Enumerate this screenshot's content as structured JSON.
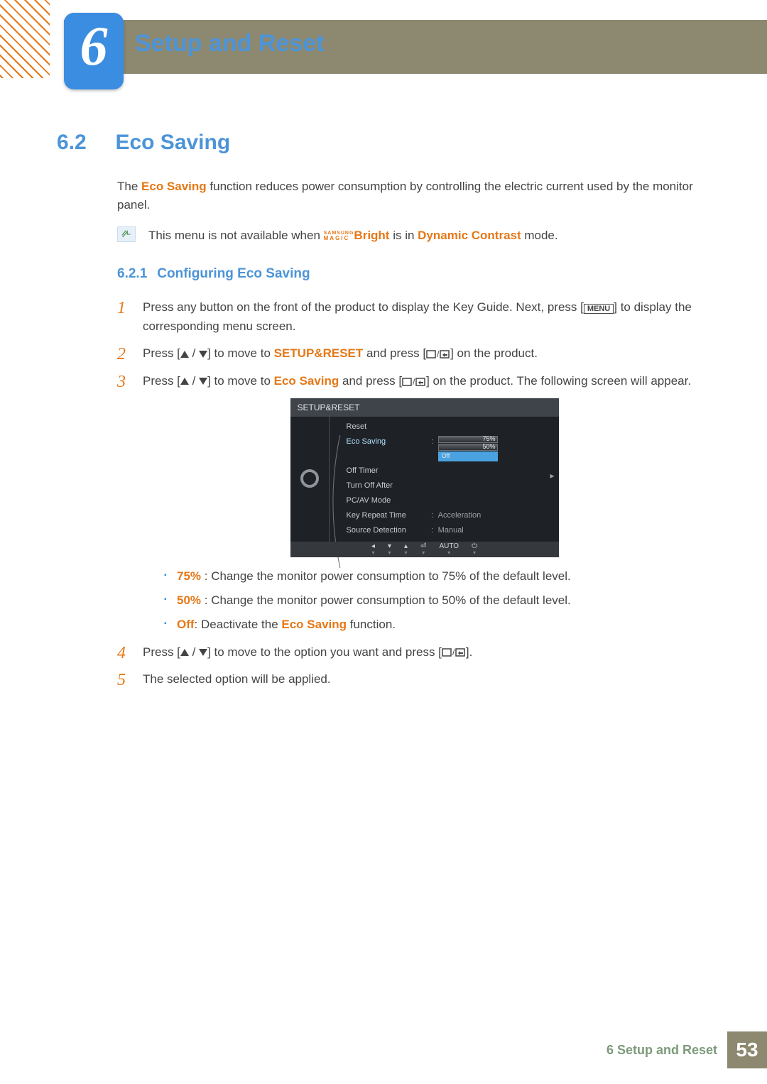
{
  "chapter": {
    "number": "6",
    "title": "Setup and Reset"
  },
  "section": {
    "number": "6.2",
    "title": "Eco Saving"
  },
  "intro": {
    "text_a": "The ",
    "eco": "Eco Saving",
    "text_b": " function reduces power consumption by controlling the electric current used by the monitor panel."
  },
  "note": {
    "text_a": "This menu is not available when ",
    "magic1": "SAMSUNG",
    "magic2": "MAGIC",
    "bright": "Bright",
    "text_b": " is in ",
    "dc": "Dynamic Contrast",
    "text_c": " mode."
  },
  "subsection": {
    "number": "6.2.1",
    "title": "Configuring Eco Saving"
  },
  "steps": {
    "s1a": "Press any button on the front of the product to display the Key Guide. Next, press [",
    "s1menu": "MENU",
    "s1b": "] to display the corresponding menu screen.",
    "s2a": "Press [",
    "s2b": "] to move to ",
    "s2target": "SETUP&RESET",
    "s2c": " and press [",
    "s2d": "] on the product.",
    "s3a": "Press [",
    "s3b": "] to move to ",
    "s3target": "Eco Saving",
    "s3c": " and press [",
    "s3d": "] on the product. The following screen will appear.",
    "s4a": "Press [",
    "s4b": "] to move to the option you want and press [",
    "s4c": "].",
    "s5": "The selected option will be applied."
  },
  "osd": {
    "title": "SETUP&RESET",
    "items": [
      {
        "k": "Reset",
        "v": ""
      },
      {
        "k": "Eco Saving",
        "v": "",
        "sel": true
      },
      {
        "k": "Off Timer",
        "v": ""
      },
      {
        "k": "Turn Off After",
        "v": ""
      },
      {
        "k": "PC/AV Mode",
        "v": ""
      },
      {
        "k": "Key Repeat Time",
        "v": "Acceleration"
      },
      {
        "k": "Source Detection",
        "v": "Manual"
      }
    ],
    "eco_opts": {
      "a": "75%",
      "b": "50%",
      "c": "Off"
    },
    "nav": [
      "◂",
      "▾",
      "▴",
      "⏎",
      "AUTO",
      "⏻"
    ]
  },
  "opts": {
    "a_key": "75%",
    "a_txt": " : Change the monitor power consumption to 75% of the default level.",
    "b_key": "50%",
    "b_txt": " : Change the monitor power consumption to 50% of the default level.",
    "c_key": "Off",
    "c_mid": ": Deactivate the ",
    "c_target": "Eco Saving",
    "c_end": " function."
  },
  "footer": {
    "chapter": "6 Setup and Reset",
    "page": "53"
  }
}
